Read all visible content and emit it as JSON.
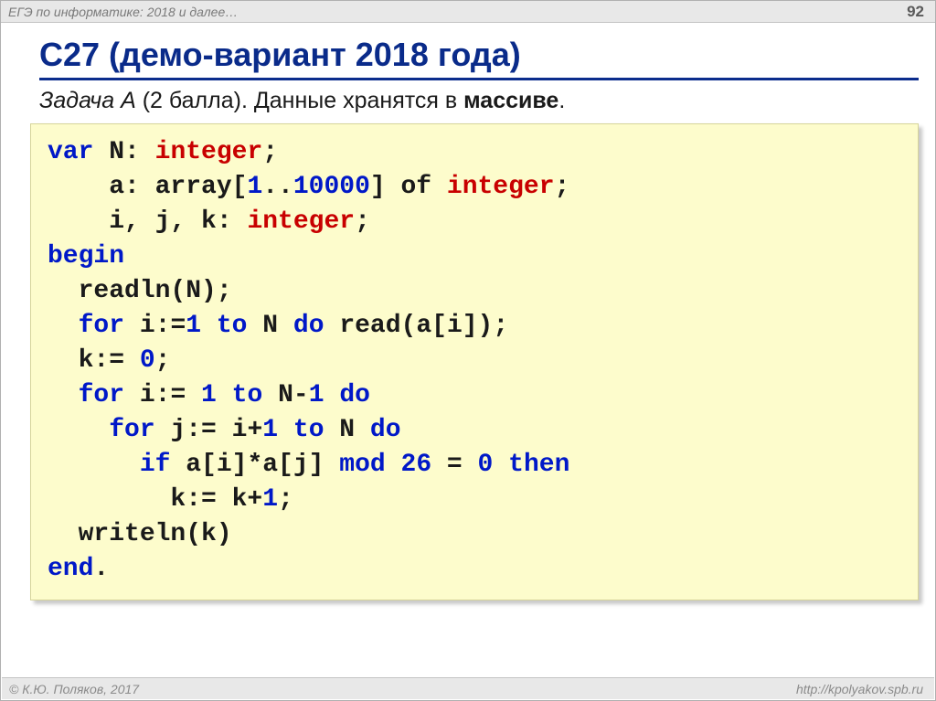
{
  "header": {
    "left": "ЕГЭ по информатике: 2018 и далее…",
    "right": "92"
  },
  "title": "C27 (демо-вариант 2018 года)",
  "subtitle": {
    "prefix_it": "Задача А",
    "middle": " (2 балла). Данные хранятся в ",
    "bold": "массиве",
    "suffix": "."
  },
  "code": {
    "l1": {
      "a": "var",
      "b": " N: ",
      "c": "integer",
      "d": ";"
    },
    "l2": {
      "a": "    a: array[",
      "b": "1",
      "c": "..",
      "d": "10000",
      "e": "] of ",
      "f": "integer",
      "g": ";"
    },
    "l3": {
      "a": "    i, j, k: ",
      "b": "integer",
      "c": ";"
    },
    "l4": {
      "a": "begin"
    },
    "l5": {
      "a": "  readln(N);"
    },
    "l6": {
      "a": "  ",
      "b": "for",
      "c": " i:=",
      "d": "1",
      "e": " ",
      "f": "to",
      "g": " N ",
      "h": "do",
      "i": " read(a[i]);"
    },
    "l7": {
      "a": "  k:= ",
      "b": "0",
      "c": ";"
    },
    "l8": {
      "a": "  ",
      "b": "for",
      "c": " i:= ",
      "d": "1",
      "e": " ",
      "f": "to",
      "g": " N-",
      "h": "1",
      "i": " ",
      "j": "do"
    },
    "l9": {
      "a": "    ",
      "b": "for",
      "c": " j:= i+",
      "d": "1",
      "e": " ",
      "f": "to",
      "g": " N ",
      "h": "do"
    },
    "l10": {
      "a": "      ",
      "b": "if",
      "c": " a[i]*a[j] ",
      "d": "mod",
      "e": " ",
      "f": "26",
      "g": " = ",
      "h": "0",
      "i": " ",
      "j": "then"
    },
    "l11": {
      "a": "        k:= k+",
      "b": "1",
      "c": ";"
    },
    "l12": {
      "a": "  writeln(k)"
    },
    "l13": {
      "a": "end",
      "b": "."
    }
  },
  "footer": {
    "left": "© К.Ю. Поляков, 2017",
    "right": "http://kpolyakov.spb.ru"
  }
}
